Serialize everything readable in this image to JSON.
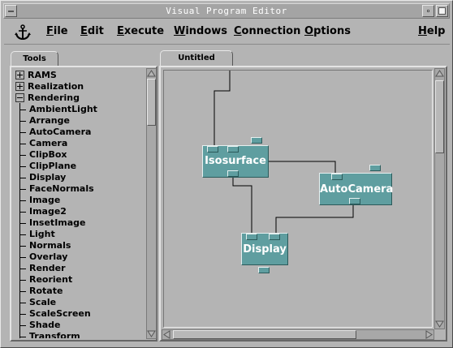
{
  "window": {
    "title": "Visual Program Editor"
  },
  "menubar": {
    "items": [
      {
        "label": "File",
        "mnemonic": "F",
        "rest": "ile"
      },
      {
        "label": "Edit",
        "mnemonic": "E",
        "rest": "dit"
      },
      {
        "label": "Execute",
        "mnemonic": "E",
        "rest": "xecute"
      },
      {
        "label": "Windows",
        "mnemonic": "W",
        "rest": "indows"
      },
      {
        "label": "Connection",
        "mnemonic": "C",
        "rest": "onnection"
      },
      {
        "label": "Options",
        "mnemonic": "O",
        "rest": "ptions"
      },
      {
        "label": "Help",
        "mnemonic": "H",
        "rest": "elp"
      }
    ],
    "icon": "anchor-icon"
  },
  "tools": {
    "tab_label": "Tools",
    "categories": [
      {
        "label": "RAMS",
        "state": "collapsed"
      },
      {
        "label": "Realization",
        "state": "collapsed"
      },
      {
        "label": "Rendering",
        "state": "expanded"
      }
    ],
    "items": [
      "AmbientLight",
      "Arrange",
      "AutoCamera",
      "Camera",
      "ClipBox",
      "ClipPlane",
      "Display",
      "FaceNormals",
      "Image",
      "Image2",
      "InsetImage",
      "Light",
      "Normals",
      "Overlay",
      "Render",
      "Reorient",
      "Rotate",
      "Scale",
      "ScaleScreen",
      "Shade",
      "Transform"
    ]
  },
  "canvas": {
    "tab_label": "Untitled",
    "modules": {
      "isosurface": "Isosurface",
      "autocamera": "AutoCamera",
      "display": "Display"
    },
    "colors": {
      "module": "#5f9ea0",
      "wire": "#000000"
    }
  }
}
